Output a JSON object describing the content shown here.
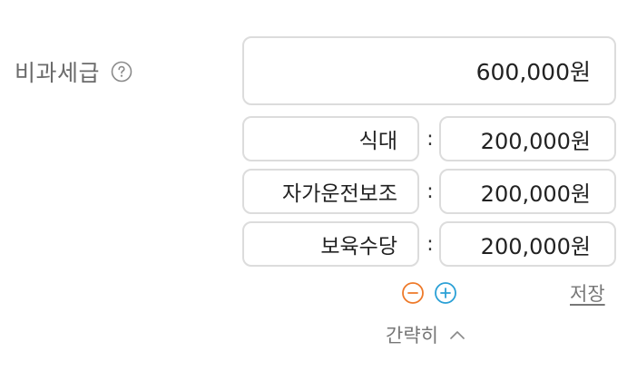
{
  "field": {
    "label": "비과세급",
    "help_icon": "question-circle-icon",
    "total": "600,000원"
  },
  "items": [
    {
      "name": "식대",
      "separator": ":",
      "amount": "200,000원"
    },
    {
      "name": "자가운전보조",
      "separator": ":",
      "amount": "200,000원"
    },
    {
      "name": "보육수당",
      "separator": ":",
      "amount": "200,000원"
    }
  ],
  "controls": {
    "remove_icon": "minus-circle-icon",
    "add_icon": "plus-circle-icon",
    "save_label": "저장",
    "collapse_label": "간략히",
    "collapse_icon": "chevron-up-icon"
  },
  "colors": {
    "remove": "#ee7a2a",
    "add": "#2aa0d6",
    "border": "#dcdcdc",
    "muted_text": "#777777"
  }
}
